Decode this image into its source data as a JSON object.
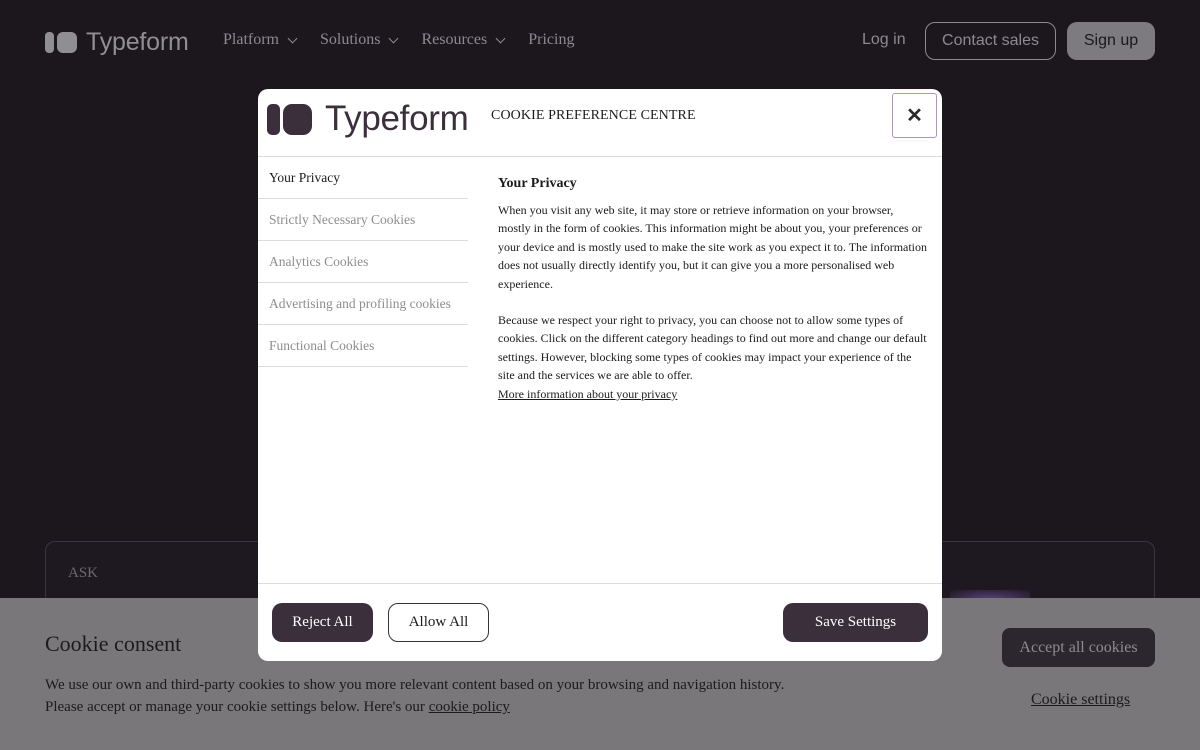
{
  "nav": {
    "brand": "Typeform",
    "links": [
      {
        "label": "Platform",
        "has_chevron": true
      },
      {
        "label": "Solutions",
        "has_chevron": true
      },
      {
        "label": "Resources",
        "has_chevron": true
      },
      {
        "label": "Pricing",
        "has_chevron": false
      }
    ],
    "login": "Log in",
    "contact_sales": "Contact sales",
    "sign_up": "Sign up"
  },
  "background": {
    "card_label": "ASK"
  },
  "cookie_bar": {
    "title": "Cookie consent",
    "text_line1": "We use our own and third-party cookies to show you more relevant content based on your browsing and navigation history.",
    "text_line2": "Please accept or manage your cookie settings below. Here's our ",
    "policy_link": "cookie policy",
    "accept_all": "Accept all cookies",
    "settings": "Cookie settings"
  },
  "modal": {
    "logo": "Typeform",
    "title": "COOKIE PREFERENCE CENTRE",
    "close_icon": "close-icon",
    "tabs": [
      "Your Privacy",
      "Strictly Necessary Cookies",
      "Analytics Cookies",
      "Advertising and profiling cookies",
      "Functional Cookies"
    ],
    "active_tab": 0,
    "content": {
      "heading": "Your Privacy",
      "para1": "When you visit any web site, it may store or retrieve information on your browser, mostly in the form of cookies. This information might be about you, your preferences or your device and is mostly used to make the site work as you expect it to. The information does not usually directly identify you, but it can give you a more personalised web experience.",
      "para2": "Because we respect your right to privacy, you can choose not to allow some types of cookies. Click on the different category headings to find out more and change our default settings. However, blocking some types of cookies may impact your experience of the site and the services we are able to offer.",
      "more_link": "More information about your privacy"
    },
    "buttons": {
      "reject_all": "Reject All",
      "allow_all": "Allow All",
      "save_settings": "Save Settings"
    }
  },
  "colors": {
    "page_bg": "#1b171d",
    "accent_dark": "#3b2f3c",
    "cookie_bar_bg": "#797779"
  }
}
